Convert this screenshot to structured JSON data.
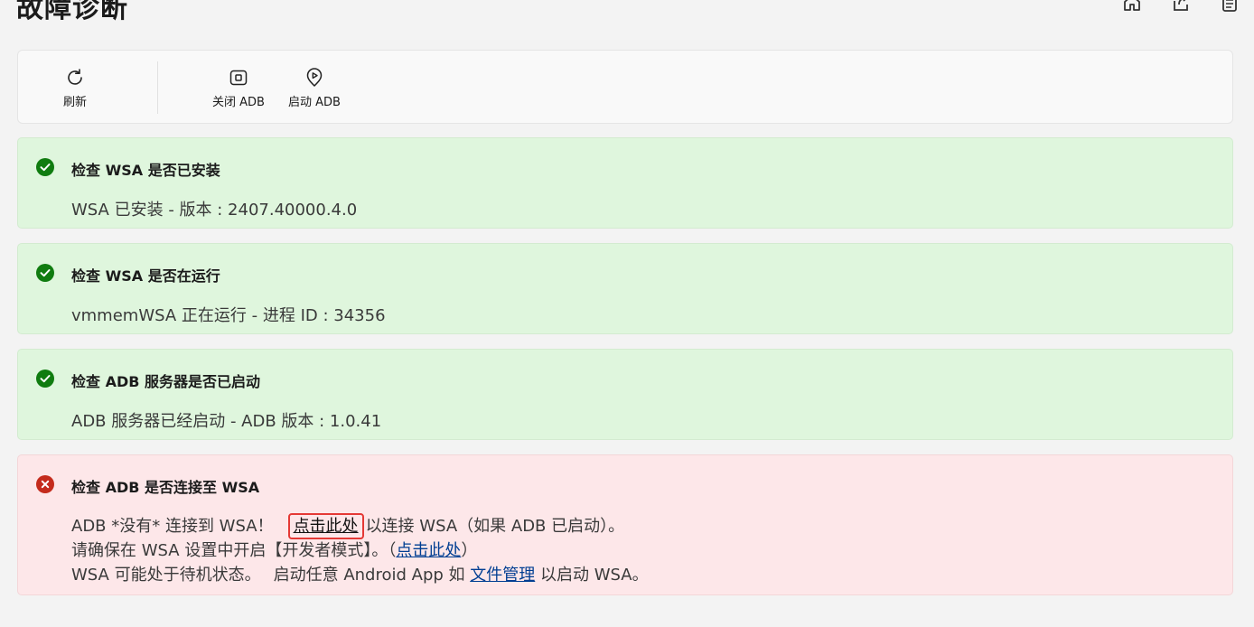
{
  "header": {
    "title": "故障诊断"
  },
  "toolbar": {
    "refresh_label": "刷新",
    "stop_adb_label": "关闭 ADB",
    "start_adb_label": "启动 ADB"
  },
  "checks": [
    {
      "status": "ok",
      "title": "检查 WSA 是否已安装",
      "detail": "WSA 已安装  -  版本 : 2407.40000.4.0"
    },
    {
      "status": "ok",
      "title": "检查 WSA 是否在运行",
      "detail": "vmmemWSA 正在运行  -  进程 ID : 34356"
    },
    {
      "status": "ok",
      "title": "检查 ADB 服务器是否已启动",
      "detail": "ADB 服务器已经启动  -  ADB 版本 : 1.0.41"
    },
    {
      "status": "error",
      "title": "检查 ADB 是否连接至 WSA",
      "line1_prefix": "ADB *没有* 连接到 WSA！",
      "line1_link": "点击此处",
      "line1_suffix": "以连接 WSA（如果 ADB 已启动）。",
      "line2_prefix": "请确保在 WSA 设置中开启【开发者模式】。（",
      "line2_link": "点击此处",
      "line2_suffix": "）",
      "line3_prefix": "WSA 可能处于待机状态。",
      "line3_middle": "启动任意 Android App 如",
      "line3_link": "文件管理",
      "line3_suffix": "以启动 WSA。"
    }
  ],
  "colors": {
    "success": "#107c10",
    "error": "#c42b1c",
    "link": "#003e92"
  }
}
